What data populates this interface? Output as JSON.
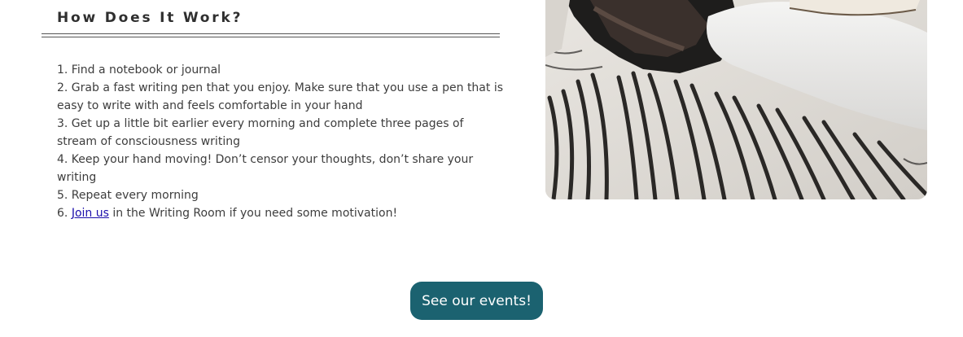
{
  "section": {
    "title": "How Does It Work?"
  },
  "steps": [
    {
      "text": "1. Find a notebook or journal"
    },
    {
      "text": "2. Grab a fast writing pen that you enjoy. Make sure that you use a pen that is easy to write with and feels comfortable in your hand"
    },
    {
      "text": "3. Get up a little bit earlier every morning and complete three pages of stream of consciousness writing"
    },
    {
      "text": "4. Keep your hand moving! Don’t censor your thoughts, don’t share your writing"
    },
    {
      "text": "5. Repeat every morning"
    },
    {
      "prefix": "6. ",
      "link": "Join us",
      "suffix": " in the Writing Room if you need some motivation!"
    }
  ],
  "cta": {
    "label": "See our events!"
  },
  "colors": {
    "button_bg": "#1b6270",
    "link": "#1a0dab"
  }
}
